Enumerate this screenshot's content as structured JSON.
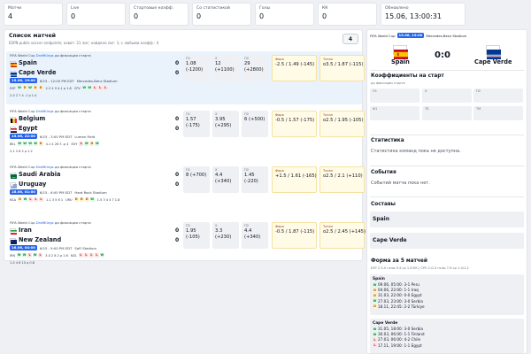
{
  "stats": [
    {
      "label": "Матчи",
      "value": "4"
    },
    {
      "label": "Live",
      "value": "0"
    },
    {
      "label": "Стартовые коэфф.",
      "value": "0"
    },
    {
      "label": "Со статистикой",
      "value": "0"
    },
    {
      "label": "Голы",
      "value": "0"
    },
    {
      "label": "КК",
      "value": "0"
    },
    {
      "label": "Обновлено",
      "value": "15.06, 13:00:31"
    }
  ],
  "list": {
    "title": "Список матчей",
    "subtitle": "ESPN public soccer endpoints; охват: 21 лиг; найдено лиг: 1; с любыми коэфф.: 4",
    "count": "4"
  },
  "colors": {
    "accent": "#2563eb",
    "win": "#15803d",
    "loss": "#b91c1c",
    "draw": "#b45309",
    "highlight": "#fffbe6"
  },
  "matches": [
    {
      "tournament": "FIFA World Cup",
      "provider": "DraftKings",
      "phase": "до фиксации старта",
      "home": "Spain",
      "away": "Cape Verde",
      "home_flag": "spain",
      "away_flag": "capeverde",
      "hs": "0",
      "as": "0",
      "time": "15.06, 19:00",
      "date_local": "6/15 - 12:00 PM EDT",
      "venue": "Mercedes-Benz Stadium",
      "home_abbr": "ESP",
      "home_form": [
        "W",
        "D",
        "W",
        "D",
        "D"
      ],
      "home_form_score": "2-3 4 9 4-1 р 1.8",
      "away_abbr": "CPV",
      "away_form": [
        "W",
        "W",
        "L",
        "L",
        "L"
      ],
      "away_form_score": "",
      "tail": "2-0 2 7 4 -1 р 1.4",
      "odds": {
        "p1": "1.08\n(-1200)",
        "x": "12\n(+1100)",
        "p2": "29\n(+2800)",
        "fora": "-2.5 / 1.49 (-145)",
        "total": "о3.5 / 1.87 (-115)"
      }
    },
    {
      "tournament": "FIFA World Cup",
      "provider": "DraftKings",
      "phase": "до фиксации старта",
      "home": "Belgium",
      "away": "Egypt",
      "home_flag": "belgium",
      "away_flag": "egypt",
      "hs": "0",
      "as": "0",
      "time": "15.06, 22:00",
      "date_local": "6/15 - 3:00 PM EDT",
      "venue": "Lumen Field",
      "home_abbr": "BEL",
      "home_form": [
        "W",
        "W",
        "W",
        "W",
        "D"
      ],
      "home_form_score": "4-1 4 26 3 -р 4",
      "away_abbr": "EGY",
      "away_form": [
        "L",
        "W",
        "D",
        "W"
      ],
      "away_form_score": "",
      "tail": "2-1 2 6 2 р 1.2",
      "odds": {
        "p1": "1.57\n(-175)",
        "x": "3.95\n(+295)",
        "p2": "6 (+500)",
        "fora": "-0.5 / 1.57 (-175)",
        "total": "о2.5 / 1.95 (-105)"
      }
    },
    {
      "tournament": "FIFA World Cup",
      "provider": "DraftKings",
      "phase": "до фиксации старта",
      "home": "Saudi Arabia",
      "away": "Uruguay",
      "home_flag": "saudi",
      "away_flag": "uruguay",
      "hs": "0",
      "as": "0",
      "time": "16.06, 01:00",
      "date_local": "6/15 - 6:00 PM EDT",
      "venue": "Hard Rock Stadium",
      "home_abbr": "KSA",
      "home_form": [
        "D",
        "W",
        "L",
        "L",
        "L"
      ],
      "home_form_score": "1-1 3 5 6 1",
      "away_abbr": "URU",
      "away_form": [
        "D",
        "D",
        "D",
        "W"
      ],
      "away_form_score": "1-5 3 4 4 7 1.8",
      "tail": "",
      "odds": {
        "p1": "8 (+700)",
        "x": "4.4\n(+340)",
        "p2": "1.45\n(-220)",
        "fora": "+1.5 / 1.61 (-165)",
        "total": "о2.5 / 2.1 (+110)"
      }
    },
    {
      "tournament": "FIFA World Cup",
      "provider": "DraftKings",
      "phase": "до фиксации старта",
      "home": "Iran",
      "away": "New Zealand",
      "home_flag": "iran",
      "away_flag": "nz",
      "hs": "0",
      "as": "0",
      "time": "16.06, 04:00",
      "date_local": "6/15 - 9:00 PM EDT",
      "venue": "SoFi Stadium",
      "home_abbr": "IRN",
      "home_form": [
        "W",
        "W",
        "L",
        "W",
        "L"
      ],
      "home_form_score": "3-0 2 8 2 р 1.6",
      "away_abbr": "NZL",
      "away_form": [
        "L",
        "L",
        "L",
        "L",
        "W"
      ],
      "away_form_score": "",
      "tail": "1-0 4 6 10 р 0.8",
      "odds": {
        "p1": "1.95\n(-105)",
        "x": "3.3\n(+230)",
        "p2": "4.4\n(+340)",
        "fora": "-0.5 / 1.87 (-115)",
        "total": "о2.5 / 2.45 (+145)"
      }
    }
  ],
  "odds_labels": {
    "p1": "П1",
    "x": "X",
    "p2": "П2",
    "fora": "Фора",
    "total": "Тотал"
  },
  "detail": {
    "tournament": "FIFA World Cup",
    "time": "15.06, 19:00",
    "venue": "Mercedes-Benz Stadium",
    "home": "Spain",
    "away": "Cape Verde",
    "score": "0:0",
    "odds_title": "Коэффициенты на старт",
    "odds_sub": "до фиксации старта",
    "odds": [
      {
        "label": "П1",
        "value": "1.08 (-1200)"
      },
      {
        "label": "X",
        "value": "12 (+1100)"
      },
      {
        "label": "П2",
        "value": "29 (+2800)"
      },
      {
        "label": "Ф1",
        "value": "-2.5 1.49 (-145)"
      },
      {
        "label": "ТБ",
        "value": "о3.5 1.87 (-115)"
      },
      {
        "label": "ТМ",
        "value": "u3.5 1.91 (-110)"
      }
    ],
    "stats_title": "Статистика",
    "stats_text": "Статистика команд пока не доступна.",
    "events_title": "События",
    "events_text": "Событий матча пока нет.",
    "lineups_title": "Составы",
    "form_title": "Форма за 5 матчей",
    "form_sub": "ESP 2.3-0 голы 9.4 ср 1.8 КК | CPV 2-0-3 голы 7-6 ср 1.4/1.2",
    "home_form": [
      {
        "r": "W",
        "t": "09.06, 05:00: 3-1 Peru"
      },
      {
        "r": "D",
        "t": "04.06, 22:00: 1-1 Iraq"
      },
      {
        "r": "D",
        "t": "31.03, 22:00: 0-0 Egypt"
      },
      {
        "r": "W",
        "t": "27.03, 23:00: 3-0 Serbia"
      },
      {
        "r": "D",
        "t": "18.11, 22:45: 2-2 Türkiye"
      }
    ],
    "away_form": [
      {
        "r": "W",
        "t": "31.05, 18:00: 3-0 Serbia"
      },
      {
        "r": "W",
        "t": "30.03, 06:00: 1-1 Finland"
      },
      {
        "r": "L",
        "t": "27.03, 06:00: 4-2 Chile"
      },
      {
        "r": "L",
        "t": "17.11, 19:00: 1-1 Egypt"
      }
    ]
  }
}
